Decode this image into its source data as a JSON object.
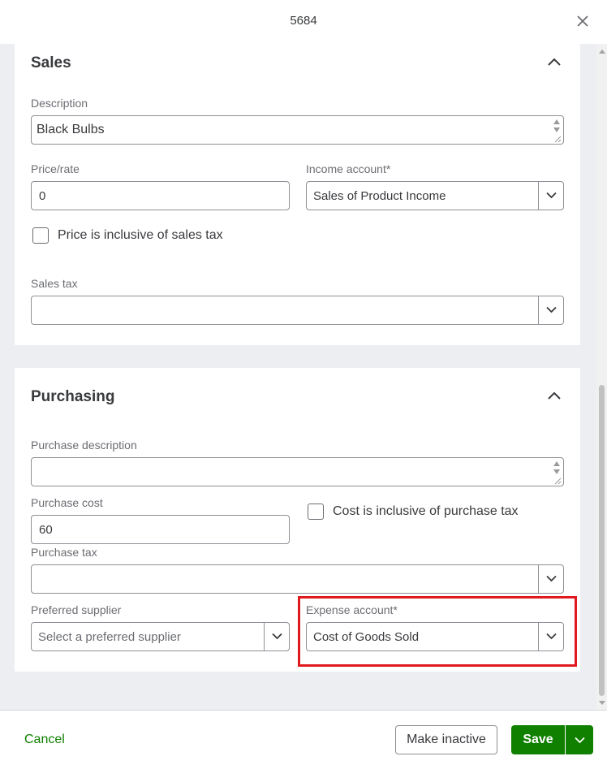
{
  "header": {
    "title": "5684",
    "close_icon": "close-icon"
  },
  "sales": {
    "title": "Sales",
    "description_label": "Description",
    "description_value": "Black Bulbs",
    "price_label": "Price/rate",
    "price_value": "0",
    "income_account_label": "Income account*",
    "income_account_value": "Sales of Product Income",
    "price_inclusive_label": "Price is inclusive of sales tax",
    "price_inclusive_checked": false,
    "sales_tax_label": "Sales tax",
    "sales_tax_value": ""
  },
  "purchasing": {
    "title": "Purchasing",
    "purchase_description_label": "Purchase description",
    "purchase_description_value": "",
    "purchase_cost_label": "Purchase cost",
    "purchase_cost_value": "60",
    "cost_inclusive_label": "Cost is inclusive of purchase tax",
    "cost_inclusive_checked": false,
    "purchase_tax_label": "Purchase tax",
    "purchase_tax_value": "",
    "preferred_supplier_label": "Preferred supplier",
    "preferred_supplier_placeholder": "Select a preferred supplier",
    "expense_account_label": "Expense account*",
    "expense_account_value": "Cost of Goods Sold"
  },
  "footer": {
    "cancel_label": "Cancel",
    "make_inactive_label": "Make inactive",
    "save_label": "Save"
  },
  "colors": {
    "accent_green": "#108000",
    "highlight_red": "#e0191f",
    "text_primary": "#393a3d",
    "text_secondary": "#6b6c72"
  }
}
